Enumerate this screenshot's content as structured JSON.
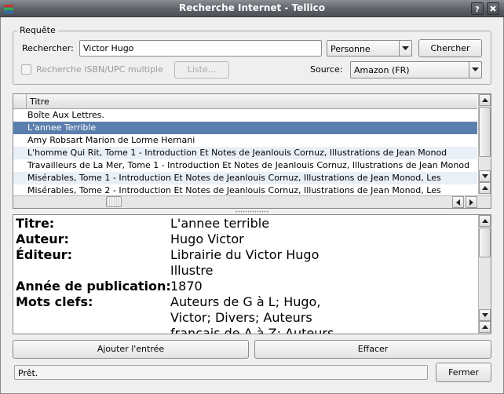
{
  "window": {
    "title": "Recherche Internet - Tellico"
  },
  "search": {
    "group_title": "Requête",
    "search_label": "Rechercher:",
    "query_value": "Victor Hugo",
    "field_select": "Personne",
    "search_button": "Chercher",
    "isbn_checkbox_label": "Recherche ISBN/UPC multiple",
    "list_button": "Liste...",
    "source_label": "Source:",
    "source_select": "Amazon (FR)"
  },
  "results": {
    "column_header": "Titre",
    "rows": [
      "Boîte Aux Lettres.",
      "L'annee Terrible",
      "Amy Robsart Marion de Lorme Hernani",
      "L'homme Qui Rit, Tome 1 - Introduction Et Notes de Jeanlouis Cornuz, Illustrations de Jean Monod",
      "Travailleurs de La Mer, Tome 1 - Introduction Et Notes de Jeanlouis Cornuz, Illustrations de Jean Monod",
      "Misérables, Tome 1 - Introduction Et Notes de Jeanlouis Cornuz, Illustrations de Jean Monod, Les",
      "Misérables, Tome 2 - Introduction Et Notes de Jeanlouis Cornuz, Illustrations de Jean Monod, Les"
    ],
    "selected_index": 1
  },
  "details": {
    "title_label": "Titre:",
    "title_value": "L'annee terrible",
    "author_label": "Auteur:",
    "author_value": "Hugo Victor",
    "publisher_label": "Éditeur:",
    "publisher_line1": "Librairie du Victor Hugo",
    "publisher_line2": "Illustre",
    "year_label": "Année de publication:",
    "year_value": "1870",
    "keywords_label": "Mots clefs:",
    "keywords_line1": "Auteurs de G à L; Hugo,",
    "keywords_line2": "Victor; Divers; Auteurs",
    "keywords_line3": "français de A à Z; Auteurs"
  },
  "actions": {
    "add_button": "Ajouter l'entrée",
    "clear_button": "Effacer",
    "close_button": "Fermer"
  },
  "status": {
    "text": "Prêt."
  }
}
